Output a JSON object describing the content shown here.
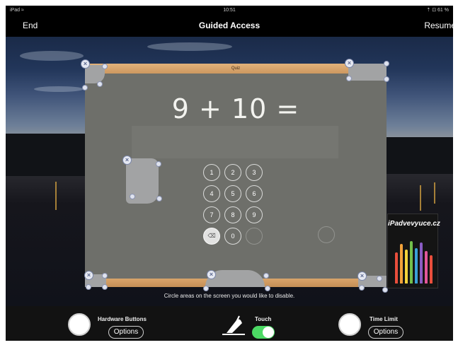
{
  "status": {
    "device": "iPad ≈",
    "time": "10:51",
    "battery": "⇡ ⊡ 61 %"
  },
  "nav": {
    "end_label": "End",
    "title": "Guided Access",
    "resume_label": "Resume"
  },
  "app": {
    "title_bar": "Quiz",
    "equation": "9 + 10 =",
    "keypad": [
      "1",
      "2",
      "3",
      "4",
      "5",
      "6",
      "7",
      "8",
      "9",
      "⌫",
      "0"
    ]
  },
  "logo_text": "iPadvevyuce.cz",
  "hint": "Circle areas on the screen you would like to disable.",
  "toolbar": {
    "hardware_label": "Hardware Buttons",
    "hardware_options": "Options",
    "touch_label": "Touch",
    "touch_enabled": true,
    "time_label": "Time Limit",
    "time_options": "Options"
  },
  "icons": {
    "close": "×",
    "touch": "hand-touch-icon",
    "delete": "backspace-icon"
  },
  "colors": {
    "toggle_on": "#4cd964",
    "quiz_bar": "#d9a56b",
    "region": "#a2a3a4"
  }
}
